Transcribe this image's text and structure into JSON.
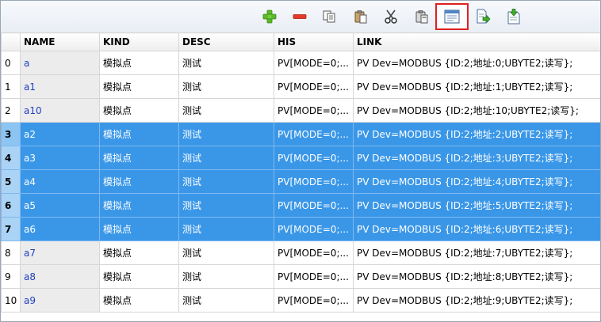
{
  "toolbar": {
    "buttons": [
      {
        "name": "add",
        "icon": "plus-icon"
      },
      {
        "name": "delete",
        "icon": "minus-icon"
      },
      {
        "name": "copy",
        "icon": "copy-icon"
      },
      {
        "name": "paste",
        "icon": "paste-icon"
      },
      {
        "name": "cut",
        "icon": "scissors-icon"
      },
      {
        "name": "paste-special",
        "icon": "clipboard-icon"
      },
      {
        "name": "batch-edit",
        "icon": "form-window-icon",
        "highlighted": true
      },
      {
        "name": "export",
        "icon": "doc-export-icon"
      },
      {
        "name": "import",
        "icon": "doc-import-icon"
      }
    ]
  },
  "grid": {
    "columns": [
      "",
      "NAME",
      "KIND",
      "DESC",
      "HIS",
      "LINK"
    ],
    "rows": [
      {
        "idx": "0",
        "name": "a",
        "kind": "模拟点",
        "desc": "测试",
        "his": "PV[MODE=0;...",
        "link": "PV Dev=MODBUS {ID:2;地址:0;UBYTE2;读写};",
        "selected": false
      },
      {
        "idx": "1",
        "name": "a1",
        "kind": "模拟点",
        "desc": "测试",
        "his": "PV[MODE=0;...",
        "link": "PV Dev=MODBUS {ID:2;地址:1;UBYTE2;读写};",
        "selected": false
      },
      {
        "idx": "2",
        "name": "a10",
        "kind": "模拟点",
        "desc": "测试",
        "his": "PV[MODE=0;...",
        "link": "PV Dev=MODBUS {ID:2;地址:10;UBYTE2;读写};",
        "selected": false
      },
      {
        "idx": "3",
        "name": "a2",
        "kind": "模拟点",
        "desc": "测试",
        "his": "PV[MODE=0;...",
        "link": "PV Dev=MODBUS {ID:2;地址:2;UBYTE2;读写};",
        "selected": true
      },
      {
        "idx": "4",
        "name": "a3",
        "kind": "模拟点",
        "desc": "测试",
        "his": "PV[MODE=0;...",
        "link": "PV Dev=MODBUS {ID:2;地址:3;UBYTE2;读写};",
        "selected": true
      },
      {
        "idx": "5",
        "name": "a4",
        "kind": "模拟点",
        "desc": "测试",
        "his": "PV[MODE=0;...",
        "link": "PV Dev=MODBUS {ID:2;地址:4;UBYTE2;读写};",
        "selected": true
      },
      {
        "idx": "6",
        "name": "a5",
        "kind": "模拟点",
        "desc": "测试",
        "his": "PV[MODE=0;...",
        "link": "PV Dev=MODBUS {ID:2;地址:5;UBYTE2;读写};",
        "selected": true
      },
      {
        "idx": "7",
        "name": "a6",
        "kind": "模拟点",
        "desc": "测试",
        "his": "PV[MODE=0;...",
        "link": "PV Dev=MODBUS {ID:2;地址:6;UBYTE2;读写};",
        "selected": true
      },
      {
        "idx": "8",
        "name": "a7",
        "kind": "模拟点",
        "desc": "测试",
        "his": "PV[MODE=0;...",
        "link": "PV Dev=MODBUS {ID:2;地址:7;UBYTE2;读写};",
        "selected": false
      },
      {
        "idx": "9",
        "name": "a8",
        "kind": "模拟点",
        "desc": "测试",
        "his": "PV[MODE=0;...",
        "link": "PV Dev=MODBUS {ID:2;地址:8;UBYTE2;读写};",
        "selected": false
      },
      {
        "idx": "10",
        "name": "a9",
        "kind": "模拟点",
        "desc": "测试",
        "his": "PV[MODE=0;...",
        "link": "PV Dev=MODBUS {ID:2;地址:9;UBYTE2;读写};",
        "selected": false
      }
    ]
  },
  "colors": {
    "selection": "#3a97e8",
    "highlight_border": "#e02020",
    "name_text": "#2040c0"
  }
}
